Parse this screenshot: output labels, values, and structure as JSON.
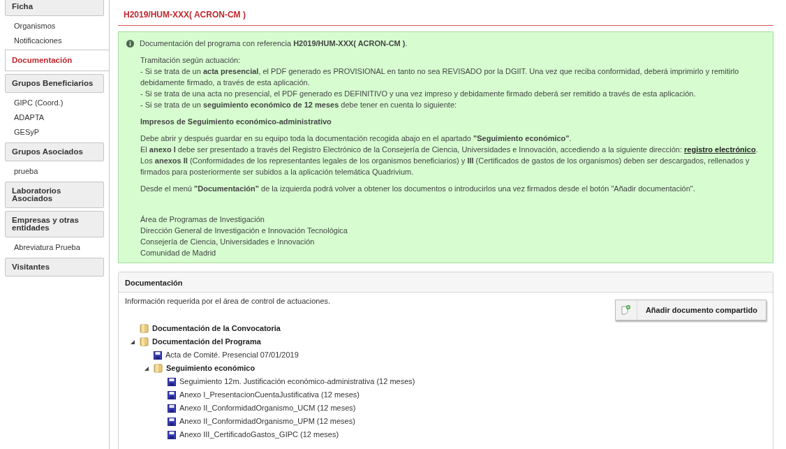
{
  "sidebar": [
    {
      "kind": "header",
      "label": "Ficha",
      "selected": false
    },
    {
      "kind": "link",
      "label": "Organismos",
      "selected": false
    },
    {
      "kind": "link",
      "label": "Notificaciones",
      "selected": false
    },
    {
      "kind": "tab",
      "label": "Documentación",
      "selected": true
    },
    {
      "kind": "header",
      "label": "Grupos Beneficiarios",
      "selected": false
    },
    {
      "kind": "link",
      "label": "GIPC (Coord.)",
      "selected": false
    },
    {
      "kind": "link",
      "label": "ADAPTA",
      "selected": false
    },
    {
      "kind": "link",
      "label": "GESyP",
      "selected": false
    },
    {
      "kind": "header",
      "label": "Grupos Asociados",
      "selected": false
    },
    {
      "kind": "link",
      "label": "prueba",
      "selected": false
    },
    {
      "kind": "header",
      "label": "Laboratorios Asociados",
      "selected": false
    },
    {
      "kind": "header",
      "label": "Empresas y otras entidades",
      "selected": false
    },
    {
      "kind": "link",
      "label": "Abreviatura Prueba",
      "selected": false
    },
    {
      "kind": "header",
      "label": "Visitantes",
      "selected": false
    }
  ],
  "title": "H2019/HUM-XXX( ACRON-CM )",
  "info": {
    "intro": "Documentación del programa con referencia **H2019/HUM-XXX( ACRON-CM )**.",
    "blocks": [
      {
        "kind": "text",
        "lines": [
          {
            "text": "Tramitación según actuación:"
          },
          {
            "text": "- Si se trata de un **acta presencial**, el PDF generado es PROVISIONAL en tanto no sea REVISADO por la DGIIT. Una vez que reciba conformidad, deberá imprimirlo y remitirlo debidamente firmado, a través de esta aplicación."
          },
          {
            "text": "- Si se trata de una acta no presencial, el PDF generado es DEFINITIVO y una vez impreso y debidamente firmado deberá ser remitido a través de esta aplicación."
          },
          {
            "text": "- Si se trata de un **seguimiento económico de 12 meses** debe tener en cuenta lo siguiente:"
          }
        ]
      },
      {
        "kind": "heading",
        "lines": [
          {
            "text": "Impresos de Seguimiento económico-administrativo"
          }
        ]
      },
      {
        "kind": "text",
        "lines": [
          {
            "text": "Debe abrir y después guardar en su equipo toda la documentación recogida abajo en el apartado **\"Seguimiento económico\"**."
          },
          {
            "text": "El **anexo I** debe ser presentado a través del Registro Electrónico de la Consejería de Ciencia, Universidades e Innovación, accediendo a la siguiente dirección: ",
            "link": "registro electrónico",
            "after": "."
          },
          {
            "text": "Los **anexos II** (Conformidades de los representantes legales de los organismos beneficiarios) y **III** (Certificados de gastos de los organismos) deben ser descargados, rellenados y firmados para posteriormente ser subidos a la aplicación telemática Quadrivium."
          }
        ]
      },
      {
        "kind": "text",
        "lines": [
          {
            "text": "Desde el menú **\"Documentación\"** de la izquierda podrá volver a obtener los documentos o introducirlos una vez firmados desde el botón \"Añadir documentación\"."
          }
        ]
      },
      {
        "kind": "signature",
        "lines": [
          {
            "text": "Área de Programas de Investigación"
          },
          {
            "text": "Dirección General de Investigación e Innovación Tecnológica"
          },
          {
            "text": "Consejería de Ciencia, Universidades e Innovación"
          },
          {
            "text": "Comunidad de Madrid"
          }
        ]
      }
    ]
  },
  "panel": {
    "title": "Documentación",
    "description": "Información requerida por el área de control de actuaciones.",
    "button": "Añadir documento compartido",
    "tree": [
      {
        "kind": "folder",
        "label": "Documentación de la Convocatoria"
      },
      {
        "kind": "folder",
        "label": "Documentación del Programa",
        "expanded": true,
        "children": [
          {
            "kind": "file",
            "label": "Acta de Comité. Presencial 07/01/2019"
          },
          {
            "kind": "folder",
            "label": "Seguimiento económico",
            "expanded": true,
            "children": [
              {
                "kind": "file",
                "label": "Seguimiento 12m. Justificación económico-administrativa (12 meses)"
              },
              {
                "kind": "file",
                "label": "Anexo I_PresentacionCuentaJustificativa (12 meses)"
              },
              {
                "kind": "file",
                "label": "Anexo II_ConformidadOrganismo_UCM (12 meses)"
              },
              {
                "kind": "file",
                "label": "Anexo II_ConformidadOrganismo_UPM (12 meses)"
              },
              {
                "kind": "file",
                "label": "Anexo III_CertificadoGastos_GIPC (12 meses)"
              }
            ]
          }
        ]
      }
    ]
  }
}
